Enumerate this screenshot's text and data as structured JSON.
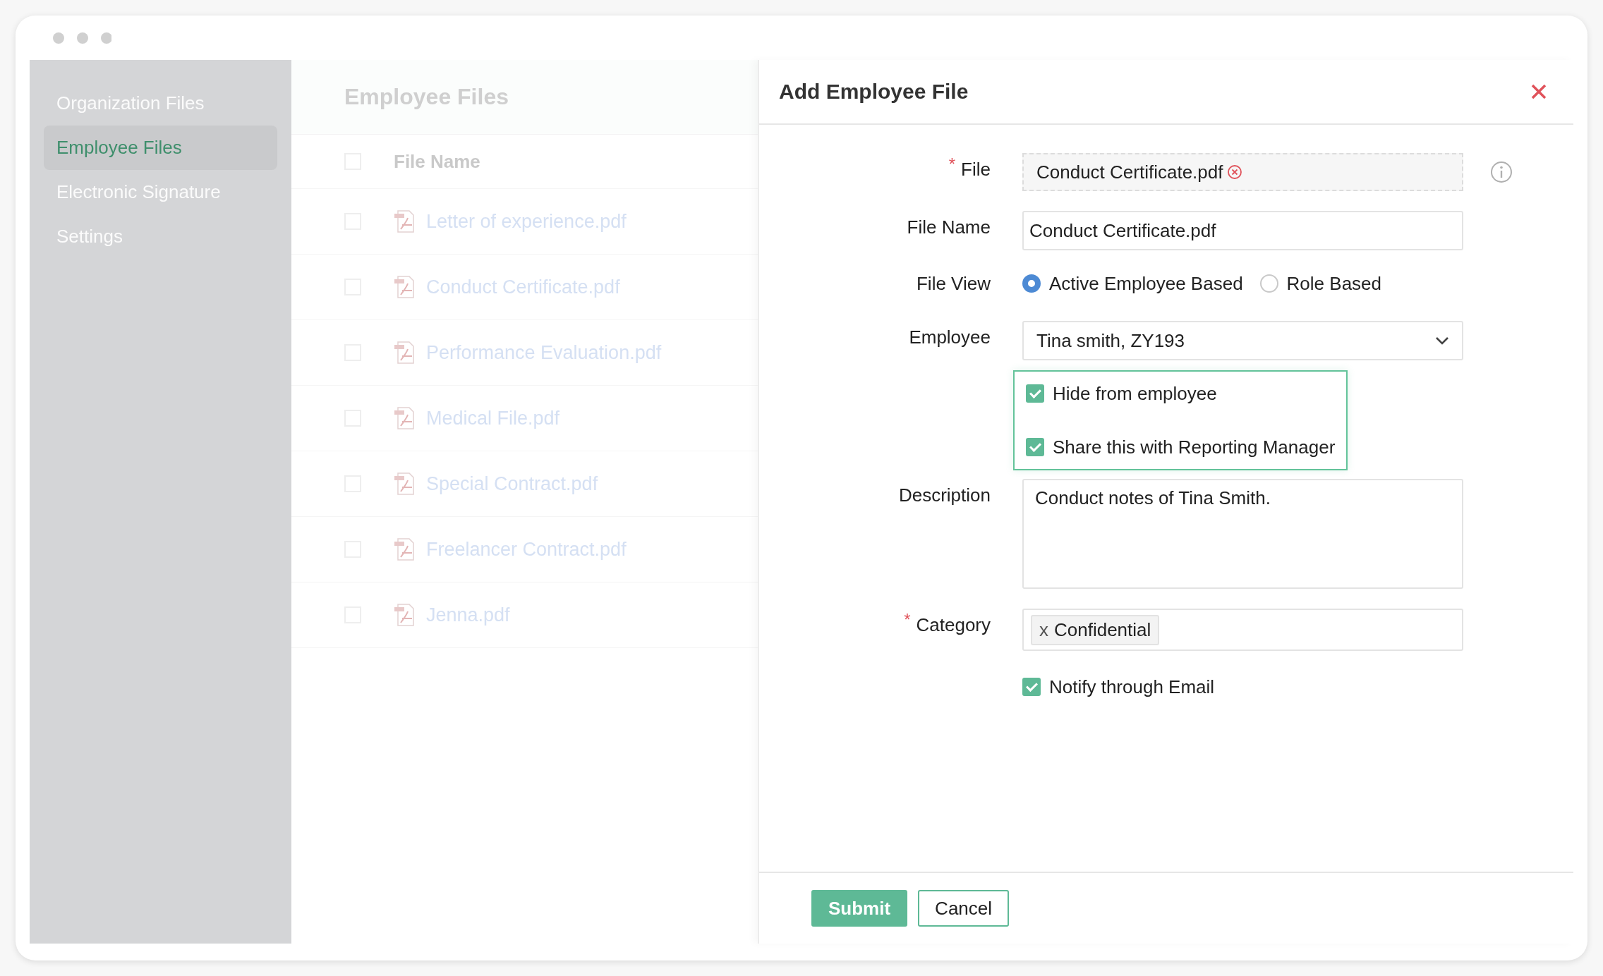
{
  "sidebar": {
    "items": [
      {
        "label": "Organization Files",
        "selected": false
      },
      {
        "label": "Employee Files",
        "selected": true
      },
      {
        "label": "Electronic Signature",
        "selected": false
      },
      {
        "label": "Settings",
        "selected": false
      }
    ]
  },
  "file_list": {
    "title": "Employee Files",
    "header": {
      "label": "File Name",
      "checked": false
    },
    "rows": [
      {
        "name": "Letter of experience.pdf",
        "checked": false
      },
      {
        "name": "Conduct Certificate.pdf",
        "checked": false
      },
      {
        "name": "Performance Evaluation.pdf",
        "checked": false
      },
      {
        "name": "Medical File.pdf",
        "checked": false
      },
      {
        "name": "Special Contract.pdf",
        "checked": false
      },
      {
        "name": "Freelancer Contract.pdf",
        "checked": false
      },
      {
        "name": "Jenna.pdf",
        "checked": false
      }
    ]
  },
  "dialog": {
    "title": "Add Employee File",
    "fields": [
      {
        "kind": "file",
        "label": "File",
        "required_mark": "*",
        "value": "Conduct Certificate.pdf"
      },
      {
        "kind": "text",
        "label": "File Name",
        "value": "Conduct Certificate.pdf"
      },
      {
        "kind": "radio",
        "label": "File View",
        "options": [
          {
            "label": "Active Employee Based",
            "selected": true
          },
          {
            "label": "Role Based",
            "selected": false
          }
        ]
      },
      {
        "kind": "select",
        "label": "Employee",
        "value": "Tina smith, ZY193"
      },
      {
        "kind": "checkgroup",
        "options": [
          {
            "label": "Hide from employee",
            "checked": true
          },
          {
            "label": "Share this with Reporting Manager",
            "checked": true
          }
        ]
      },
      {
        "kind": "textarea",
        "label": "Description",
        "value": "Conduct notes of Tina Smith."
      },
      {
        "kind": "tags",
        "label": "Category",
        "required_mark": "*",
        "tags": [
          {
            "remove": "x",
            "label": "Confidential"
          }
        ]
      },
      {
        "kind": "checkbox",
        "label": "Notify through Email",
        "checked": true
      }
    ],
    "buttons": [
      {
        "label": "Submit",
        "kind": "primary"
      },
      {
        "label": "Cancel",
        "kind": "secondary"
      }
    ]
  }
}
